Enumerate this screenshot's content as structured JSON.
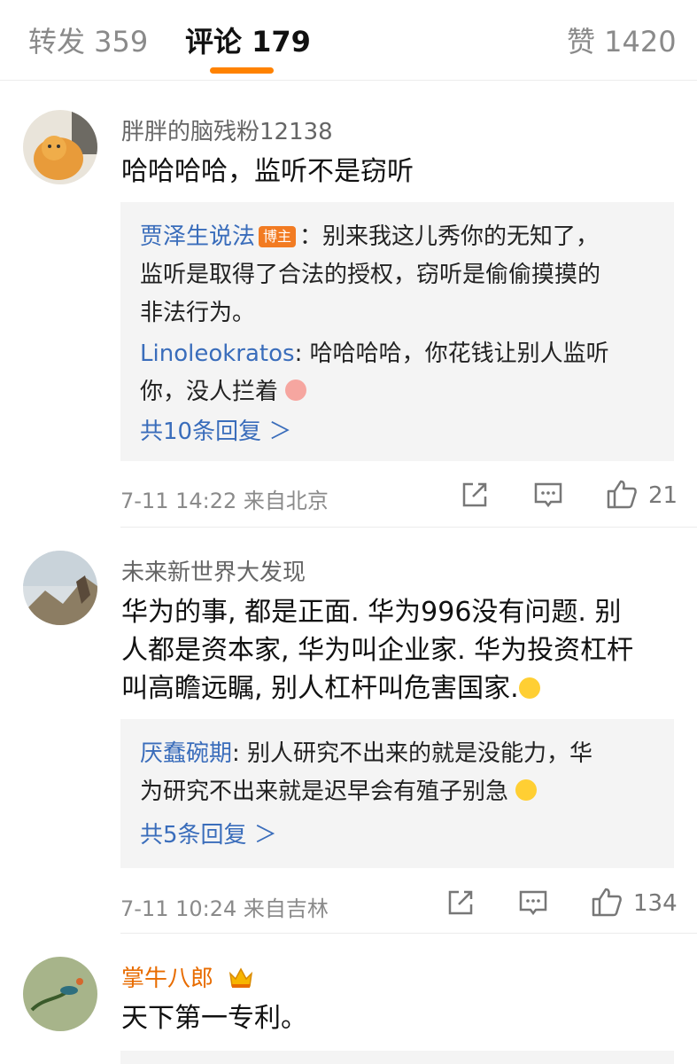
{
  "tabs": {
    "repost": "转发 359",
    "comment": "评论 179",
    "like": "赞 1420"
  },
  "comments": [
    {
      "user": "胖胖的脑残粉12138",
      "text": "哈哈哈哈，监听不是窃听",
      "replies": [
        {
          "author": "贾泽生说法",
          "badge": "博主",
          "text": "：别来我这儿秀你的无知了，"
        },
        {
          "text": "监听是取得了合法的授权，窃听是偷偷摸摸的"
        },
        {
          "text": "非法行为。"
        },
        {
          "author": "Linoleokratos",
          "text": ": 哈哈哈哈，你花钱让别人监听"
        },
        {
          "text": "你，没人拦着"
        }
      ],
      "more": "共10条回复 ＞",
      "time_place": "7-11 14:22  来自北京",
      "likes": "21"
    },
    {
      "user": "未来新世界大发现",
      "text_lines": [
        "华为的事, 都是正面. 华为996没有问题. 别",
        "人都是资本家, 华为叫企业家. 华为投资杠杆",
        "叫高瞻远瞩, 别人杠杆叫危害国家."
      ],
      "replies": [
        {
          "author": "厌蠢碗期",
          "text": ": 别人研究不出来的就是没能力，华"
        },
        {
          "text": "为研究不出来就是迟早会有殖子别急"
        }
      ],
      "more": "共5条回复 ＞",
      "time_place": "7-11 10:24  来自吉林",
      "likes": "134"
    },
    {
      "user": "掌牛八郎",
      "text": "天下第一专利。"
    }
  ],
  "colors": {
    "accent": "#ff8200",
    "link": "#3a6dbb",
    "reply_bg": "#f4f4f4"
  }
}
